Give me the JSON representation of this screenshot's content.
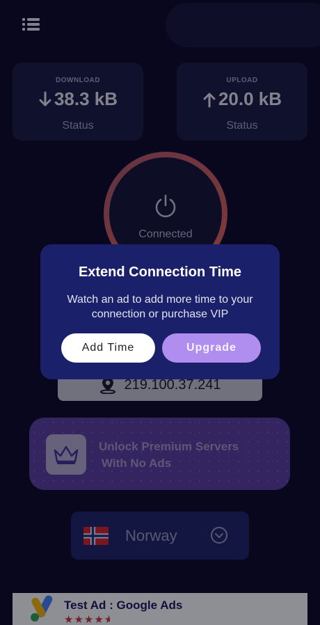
{
  "colors": {
    "background": "#0b0a25",
    "card": "#1b1d42",
    "ring": "#e66a54",
    "dialog": "#1a216a",
    "upgrade_button": "#b08ef0",
    "promo": "#5c3e9e",
    "server_selector": "#222668"
  },
  "header": {
    "menu_icon": "list-menu-icon"
  },
  "stats": {
    "download": {
      "title": "DOWNLOAD",
      "value": "38.3 kB",
      "subtitle": "Status",
      "icon": "arrow-down-icon"
    },
    "upload": {
      "title": "UPLOAD",
      "value": "20.0 kB",
      "subtitle": "Status",
      "icon": "arrow-up-icon"
    }
  },
  "connection": {
    "status": "Connected",
    "icon": "power-icon"
  },
  "ip": {
    "address": "219.100.37.241",
    "icon": "location-pin-icon"
  },
  "promo": {
    "line1": "Unlock Premium Servers",
    "line2": "With No Ads",
    "icon": "crown-icon"
  },
  "server": {
    "country": "Norway",
    "icon": "norway-flag-icon",
    "dropdown_icon": "chevron-down-circle-icon"
  },
  "ad": {
    "title": "Test Ad : Google Ads",
    "stars": "★★★★",
    "rating": 4.5,
    "icon": "google-ads-logo-icon"
  },
  "dialog": {
    "title": "Extend Connection Time",
    "message": "Watch an ad to add more time to your connection or purchase VIP",
    "add_time_label": "Add Time",
    "upgrade_label": "Upgrade"
  }
}
